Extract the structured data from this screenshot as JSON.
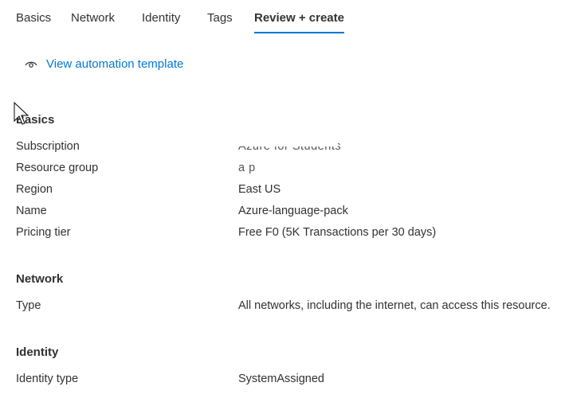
{
  "tabs": [
    {
      "label": "Basics",
      "active": false
    },
    {
      "label": "Network",
      "active": false
    },
    {
      "label": "Identity",
      "active": false
    },
    {
      "label": "Tags",
      "active": false
    },
    {
      "label": "Review + create",
      "active": true
    }
  ],
  "automation_link": {
    "label": "View automation template",
    "icon": "eye-icon"
  },
  "sections": {
    "basics": {
      "title": "Basics",
      "rows": [
        {
          "label": "Subscription",
          "value": "Azure for Students"
        },
        {
          "label": "Resource group",
          "value": "a          p"
        },
        {
          "label": "Region",
          "value": "East US"
        },
        {
          "label": "Name",
          "value": "Azure-language-pack"
        },
        {
          "label": "Pricing tier",
          "value": "Free F0 (5K Transactions per 30 days)"
        }
      ]
    },
    "network": {
      "title": "Network",
      "rows": [
        {
          "label": "Type",
          "value": "All networks, including the internet, can access this resource."
        }
      ]
    },
    "identity": {
      "title": "Identity",
      "rows": [
        {
          "label": "Identity type",
          "value": "SystemAssigned"
        }
      ]
    }
  },
  "colors": {
    "accent": "#0078d4",
    "text": "#323130"
  }
}
